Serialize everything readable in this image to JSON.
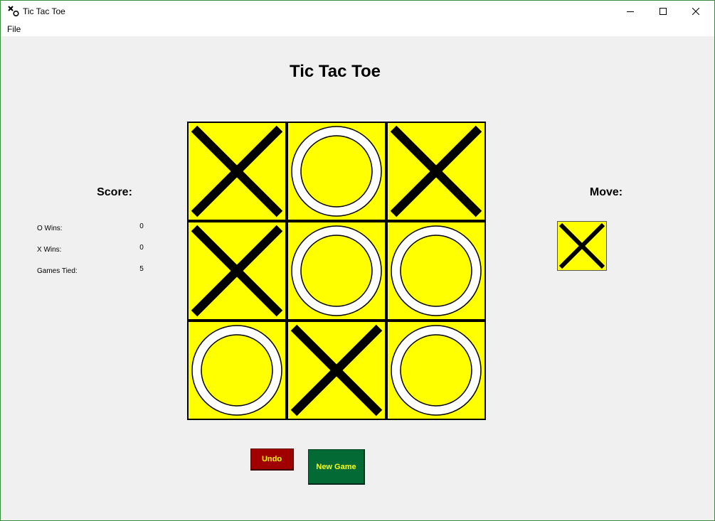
{
  "window": {
    "title": "Tic Tac Toe"
  },
  "menu": {
    "file_label": "File"
  },
  "game": {
    "title": "Tic Tac Toe",
    "board": [
      "X",
      "O",
      "X",
      "X",
      "O",
      "O",
      "O",
      "X",
      "O"
    ],
    "current_move": "X"
  },
  "score": {
    "heading": "Score:",
    "o_wins_label": "O Wins:",
    "o_wins_value": "0",
    "x_wins_label": "X Wins:",
    "x_wins_value": "0",
    "tied_label": "Games Tied:",
    "tied_value": "5"
  },
  "move": {
    "heading": "Move:"
  },
  "buttons": {
    "undo_label": "Undo",
    "new_game_label": "New Game"
  },
  "colors": {
    "cell_background": "#ffff00",
    "x_mark": "#000000",
    "o_ring_fill": "#ffffff",
    "undo_background": "#a00000",
    "new_game_background": "#036a36",
    "button_text": "#ffff00"
  },
  "icons": {
    "app": "tic-tac-toe-icon",
    "minimize": "minimize-icon",
    "maximize": "maximize-icon",
    "close": "close-icon"
  }
}
